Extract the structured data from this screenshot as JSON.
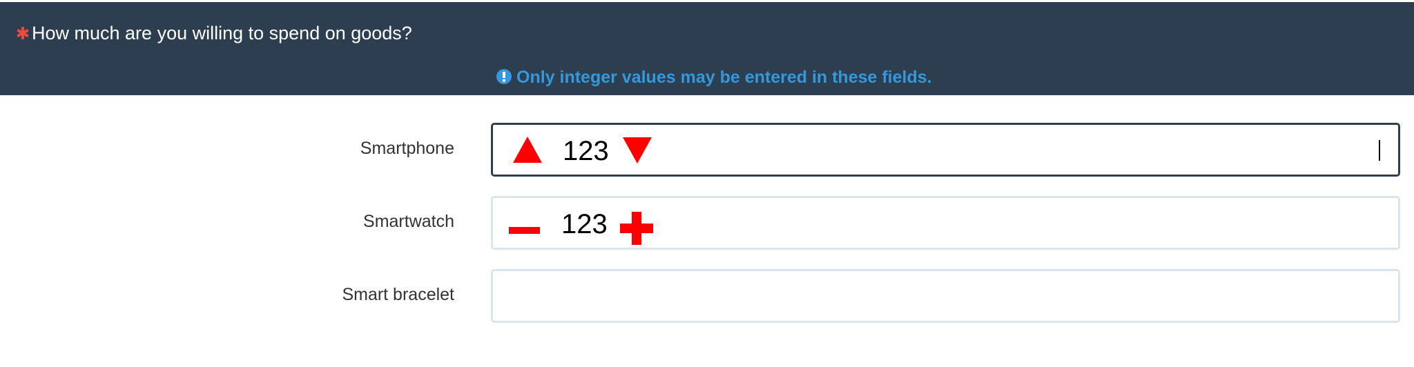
{
  "question": {
    "text": "How much are you willing to spend on goods?",
    "required_marker_color": "#e74c3c"
  },
  "hint": {
    "text": "Only integer values may be entered in these fields.",
    "icon": "info-circle-icon",
    "color": "#3498db"
  },
  "fields": [
    {
      "label": "Smartphone",
      "value": "123",
      "increment_icon": "triangle-up-icon",
      "decrement_icon": "triangle-down-icon",
      "focused": true
    },
    {
      "label": "Smartwatch",
      "value": "123",
      "decrement_icon": "minus-icon",
      "increment_icon": "plus-icon",
      "focused": false
    },
    {
      "label": "Smart bracelet",
      "value": "",
      "focused": false
    }
  ],
  "colors": {
    "header_bg": "#2c3e50",
    "stepper_red": "#ff0000",
    "field_border": "#dce4ec",
    "focused_border": "#2c3e50"
  }
}
